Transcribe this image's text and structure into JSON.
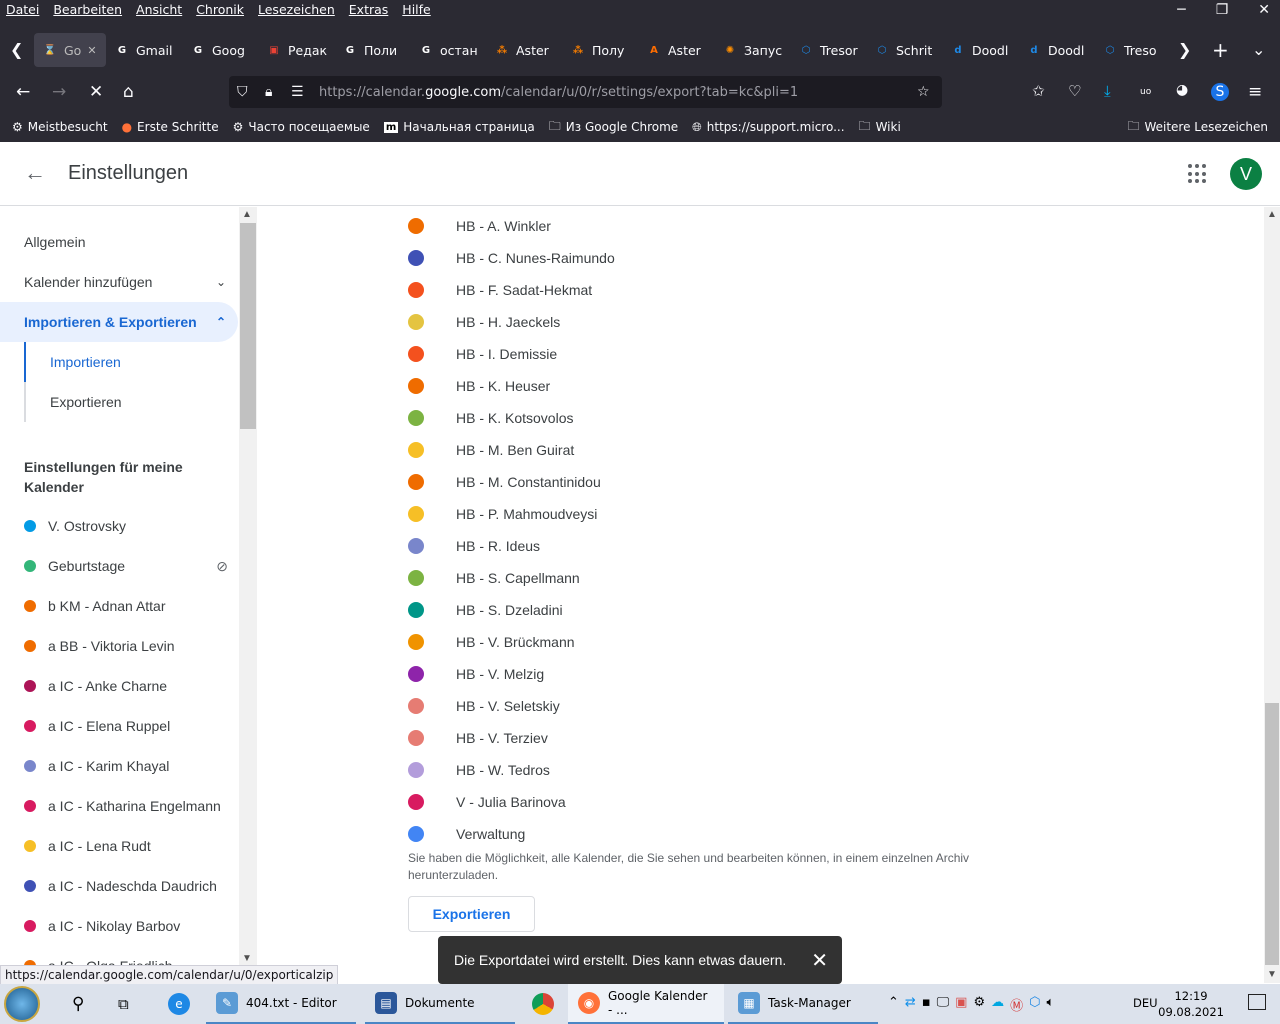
{
  "browser": {
    "menu": [
      "Datei",
      "Bearbeiten",
      "Ansicht",
      "Chronik",
      "Lesezeichen",
      "Extras",
      "Hilfe"
    ],
    "tabs": [
      {
        "label": "Go",
        "color": "#888888",
        "glyph": "⌛"
      },
      {
        "label": "Gmail",
        "color": "#ffffff",
        "glyph": "G"
      },
      {
        "label": "Goog",
        "color": "#ffffff",
        "glyph": "G"
      },
      {
        "label": "Редак",
        "color": "#e94235",
        "glyph": "▣"
      },
      {
        "label": "Поли",
        "color": "#ffffff",
        "glyph": "G"
      },
      {
        "label": "остан",
        "color": "#ffffff",
        "glyph": "G"
      },
      {
        "label": "Aster",
        "color": "#f57c00",
        "glyph": "⁂"
      },
      {
        "label": "Полу",
        "color": "#f57c00",
        "glyph": "⁂"
      },
      {
        "label": "Aster",
        "color": "#ff6d00",
        "glyph": "A"
      },
      {
        "label": "Запус",
        "color": "#ff8f00",
        "glyph": "✺"
      },
      {
        "label": "Tresor",
        "color": "#1e88e5",
        "glyph": "⬡"
      },
      {
        "label": "Schrit",
        "color": "#1e88e5",
        "glyph": "⬡"
      },
      {
        "label": "Doodl",
        "color": "#1e88e5",
        "glyph": "d"
      },
      {
        "label": "Doodl",
        "color": "#1e88e5",
        "glyph": "d"
      },
      {
        "label": "Treso",
        "color": "#1e88e5",
        "glyph": "⬡"
      }
    ],
    "url_prefix": "https://calendar.",
    "url_host": "google.com",
    "url_path": "/calendar/u/0/r/settings/export?tab=kc&pli=1",
    "bookmarks": [
      "Meistbesucht",
      "Erste Schritte",
      "Часто посещаемые",
      "Начальная страница",
      "Из Google Chrome",
      "https://support.micro...",
      "Wiki"
    ],
    "bookmarks_right": "Weitere Lesezeichen",
    "status_url": "https://calendar.google.com/calendar/u/0/exporticalzip"
  },
  "header": {
    "title": "Einstellungen",
    "avatar_letter": "V",
    "avatar_color": "#0b8043"
  },
  "sidebar": {
    "items": [
      {
        "label": "Allgemein"
      },
      {
        "label": "Kalender hinzufügen",
        "chevron": "⌄"
      },
      {
        "label": "Importieren & Exportieren",
        "chevron": "⌃"
      }
    ],
    "subitems": [
      "Importieren",
      "Exportieren"
    ],
    "my_calendars_heading": "Einstellungen für meine Kalender",
    "calendars": [
      {
        "label": "V. Ostrovsky",
        "color": "#039be5"
      },
      {
        "label": "Geburtstage",
        "color": "#33b679",
        "hidden_icon": "eye-off-icon"
      },
      {
        "label": "b KM - Adnan Attar",
        "color": "#ef6c00"
      },
      {
        "label": "a BB - Viktoria Levin",
        "color": "#ef6c00"
      },
      {
        "label": "a IC - Anke Charne",
        "color": "#ad1457"
      },
      {
        "label": "a IC - Elena Ruppel",
        "color": "#d81b60"
      },
      {
        "label": "a IC - Karim Khayal",
        "color": "#7986cb"
      },
      {
        "label": "a IC - Katharina Engelmann",
        "color": "#d81b60"
      },
      {
        "label": "a IC - Lena Rudt",
        "color": "#f6bf26"
      },
      {
        "label": "a IC - Nadeschda Daudrich",
        "color": "#3f51b5"
      },
      {
        "label": "a IC - Nikolay Barbov",
        "color": "#d81b60"
      },
      {
        "label": "a IC - Olga Friedlich",
        "color": "#ef6c00"
      }
    ]
  },
  "main": {
    "calendars": [
      {
        "label": "HB - A. Winkler",
        "color": "#ef6c00"
      },
      {
        "label": "HB - C. Nunes-Raimundo",
        "color": "#3f51b5"
      },
      {
        "label": "HB - F. Sadat-Hekmat",
        "color": "#f4511e"
      },
      {
        "label": "HB - H. Jaeckels",
        "color": "#e4c441"
      },
      {
        "label": "HB - I. Demissie",
        "color": "#f4511e"
      },
      {
        "label": "HB - K. Heuser",
        "color": "#ef6c00"
      },
      {
        "label": "HB - K. Kotsovolos",
        "color": "#7cb342"
      },
      {
        "label": "HB - M. Ben Guirat",
        "color": "#f6bf26"
      },
      {
        "label": "HB - M. Constantinidou",
        "color": "#ef6c00"
      },
      {
        "label": "HB - P. Mahmoudveysi",
        "color": "#f6bf26"
      },
      {
        "label": "HB - R. Ideus",
        "color": "#7986cb"
      },
      {
        "label": "HB - S. Capellmann",
        "color": "#7cb342"
      },
      {
        "label": "HB - S. Dzeladini",
        "color": "#009688"
      },
      {
        "label": "HB - V. Brückmann",
        "color": "#f09300"
      },
      {
        "label": "HB - V. Melzig",
        "color": "#8e24aa"
      },
      {
        "label": "HB - V. Seletskiy",
        "color": "#e67c73"
      },
      {
        "label": "HB - V. Terziev",
        "color": "#e67c73"
      },
      {
        "label": "HB - W. Tedros",
        "color": "#b39ddb"
      },
      {
        "label": "V - Julia Barinova",
        "color": "#d81b60"
      },
      {
        "label": "Verwaltung",
        "color": "#4285f4"
      }
    ],
    "hint": "Sie haben die Möglichkeit, alle Kalender, die Sie sehen und bearbeiten können, in einem einzelnen Archiv herunterzuladen.",
    "export_button": "Exportieren"
  },
  "toast": {
    "message": "Die Exportdatei wird erstellt. Dies kann etwas dauern."
  },
  "taskbar": {
    "items": [
      {
        "label": "404.txt - Editor",
        "color": "#5b9bd5"
      },
      {
        "label": "Dokumente",
        "color": "#2b579a"
      },
      {
        "label": "Google Kalender - ...",
        "color": "#ff7139"
      },
      {
        "label": "Task-Manager",
        "color": "#5b9bd5"
      }
    ],
    "lang": "DEU",
    "time": "12:19",
    "date": "09.08.2021"
  }
}
